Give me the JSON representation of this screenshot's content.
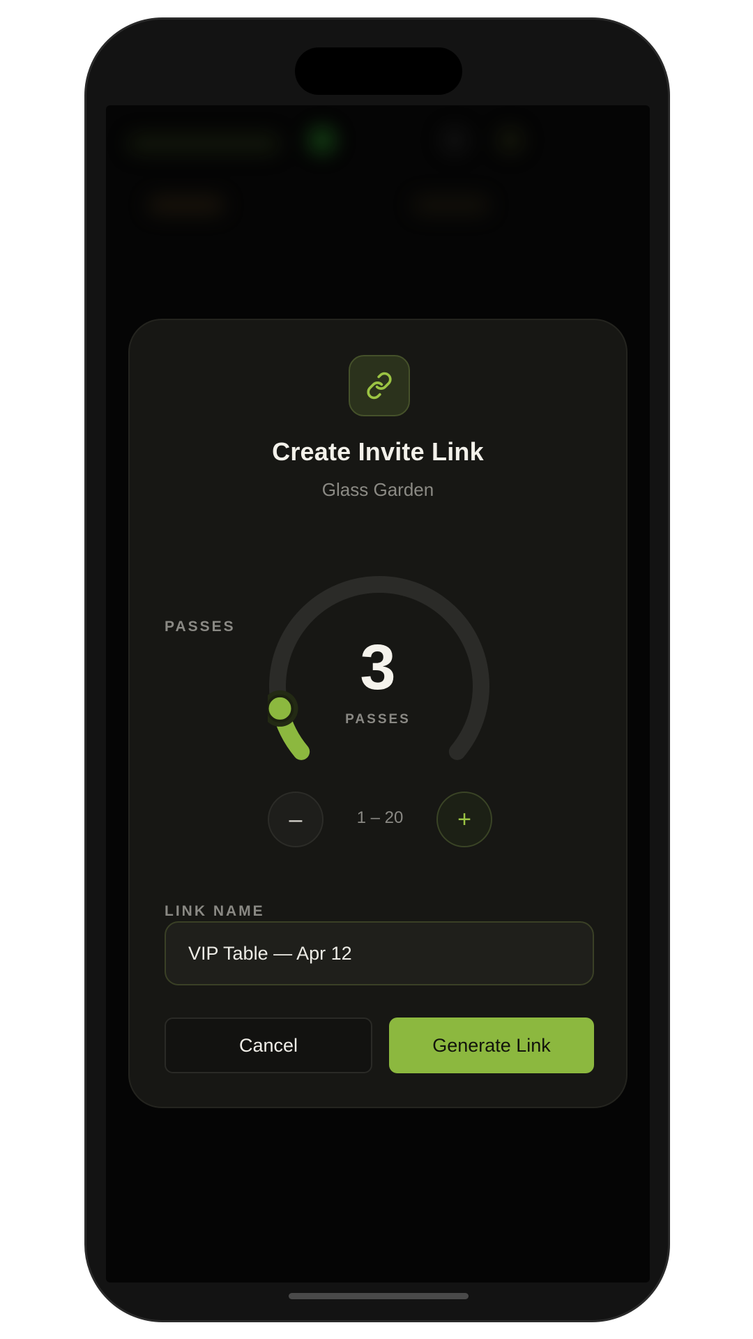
{
  "modal": {
    "title": "Create Invite Link",
    "venue": "Glass Garden",
    "passes_section_label": "PASSES",
    "passes": {
      "value": "3",
      "unit_label": "PASSES",
      "min": 1,
      "max": 20,
      "range_label": "1 – 20",
      "decrement_label": "–",
      "increment_label": "+"
    },
    "link_name_label": "LINK NAME",
    "link_name_value": "VIP Table — Apr 12",
    "cancel_label": "Cancel",
    "generate_label": "Generate Link"
  },
  "colors": {
    "accent": "#8cb83f",
    "track": "#2b2b28",
    "modal_bg": "#171714"
  },
  "icons": {
    "badge": "link-icon"
  }
}
